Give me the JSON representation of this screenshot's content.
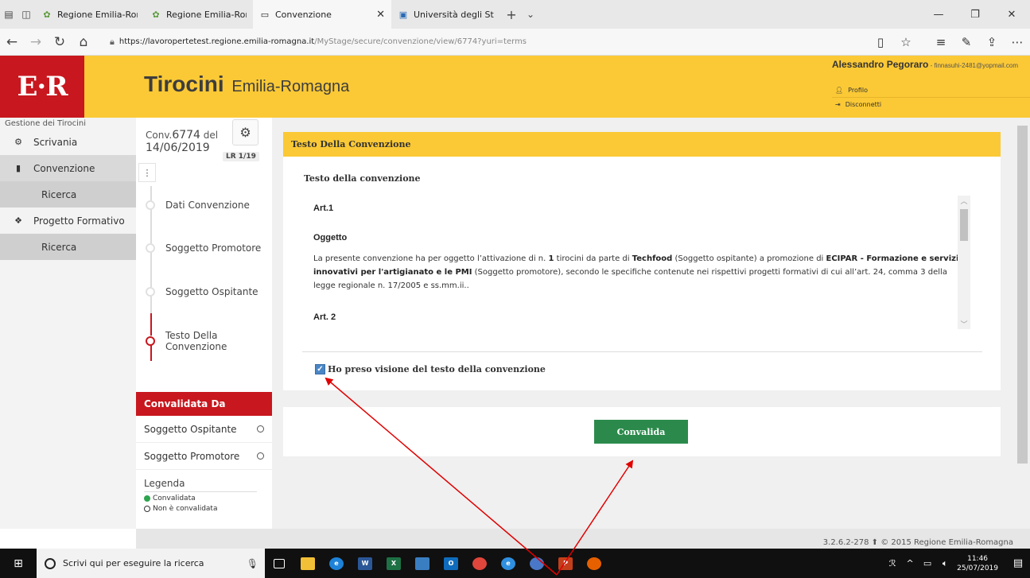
{
  "browser": {
    "tabs": [
      {
        "title": "Regione Emilia-Romagna - I",
        "active": false
      },
      {
        "title": "Regione Emilia-Romagna -",
        "active": false
      },
      {
        "title": "Convenzione",
        "active": true
      },
      {
        "title": "Università degli Studi di Par",
        "active": false
      }
    ],
    "url_host": "https://lavoropertetest.regione.emilia-romagna.it",
    "url_path": "/MyStage/secure/convenzione/view/6774?yuri=terms"
  },
  "header": {
    "logo": "E·R",
    "title_bold": "Tirocini",
    "title_rest": "Emilia-Romagna",
    "user_name": "Alessandro Pegoraro",
    "user_email": " - finnasuhi-2481@yopmail.com",
    "links": [
      "Profilo",
      "Disconnetti"
    ]
  },
  "sidebar": {
    "heading": "Gestione dei Tirocini",
    "items": [
      {
        "label": "Scrivania"
      },
      {
        "label": "Convenzione"
      },
      {
        "label": "Ricerca"
      },
      {
        "label": "Progetto Formativo"
      },
      {
        "label": "Ricerca"
      }
    ]
  },
  "midcol": {
    "conv_prefix": "Conv.",
    "conv_number": "6774",
    "conv_del": " del",
    "conv_date": "14/06/2019",
    "badge": "LR 1/19",
    "steps": [
      "Dati Convenzione",
      "Soggetto Promotore",
      "Soggetto Ospitante",
      "Testo Della Convenzione"
    ],
    "validated_title": "Convalidata Da",
    "validated_rows": [
      "Soggetto Ospitante",
      "Soggetto Promotore"
    ],
    "legend_title": "Legenda",
    "legend_items": [
      "Convalidata",
      "Non è convalidata"
    ]
  },
  "main": {
    "card_title": "Testo Della Convenzione",
    "subtitle": "Testo della convenzione",
    "art1": "Art.1",
    "oggetto": "Oggetto",
    "para_1": "La presente convenzione ha per oggetto l’attivazione di n. ",
    "para_n": "1",
    "para_2": " tirocini da parte di ",
    "para_host": "Techfood",
    "para_3": " (Soggetto ospitante) a promozione di ",
    "para_promoter": "ECIPAR - Formazione e servizi innovativi per l'artigianato e le PMI",
    "para_4": " (Soggetto promotore), secondo le specifiche contenute nei rispettivi progetti formativi di cui all’art. 24, comma 3 della legge regionale n. 17/2005 e ss.mm.ii..",
    "art2": "Art. 2",
    "checkbox_label": "Ho preso visione del testo della convenzione",
    "checkbox_checked": true,
    "button_label": "Convalida"
  },
  "footer": {
    "version": "3.2.6.2-278 ⬆ © 2015 Regione Emilia-Romagna"
  },
  "taskbar": {
    "search_placeholder": "Scrivi qui per eseguire la ricerca",
    "time": "11:46",
    "date": "25/07/2019"
  },
  "colors": {
    "header_yellow": "#fbc936",
    "brand_red": "#c8171e",
    "button_green": "#2b8a4b",
    "arrow_red": "#e00000"
  }
}
